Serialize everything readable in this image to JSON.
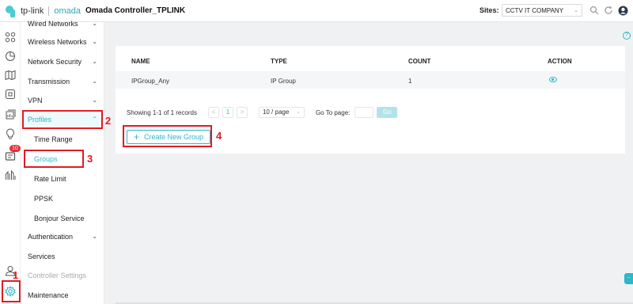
{
  "topbar": {
    "brand": "tp-link",
    "product": "omada",
    "title": "Omada Controller_TPLINK",
    "sites_label": "Sites:",
    "site_selected": "CCTV IT COMPANY"
  },
  "sidebar": {
    "items": [
      {
        "label": "Wired Networks",
        "chevron": "⌄"
      },
      {
        "label": "Wireless Networks",
        "chevron": "⌄"
      },
      {
        "label": "Network Security",
        "chevron": "⌄"
      },
      {
        "label": "Transmission",
        "chevron": "⌄"
      },
      {
        "label": "VPN",
        "chevron": "⌄"
      },
      {
        "label": "Profiles",
        "chevron": "⌃"
      },
      {
        "label": "Time Range"
      },
      {
        "label": "Groups"
      },
      {
        "label": "Rate Limit"
      },
      {
        "label": "PPSK"
      },
      {
        "label": "Bonjour Service"
      },
      {
        "label": "Authentication",
        "chevron": "⌄"
      },
      {
        "label": "Services"
      },
      {
        "label": "Controller Settings"
      },
      {
        "label": "Maintenance"
      }
    ]
  },
  "rail": {
    "badge_count": "10"
  },
  "table": {
    "headers": [
      "NAME",
      "TYPE",
      "COUNT",
      "ACTION"
    ],
    "rows": [
      {
        "name": "IPGroup_Any",
        "type": "IP Group",
        "count": "1",
        "action": "view-icon"
      }
    ]
  },
  "pager": {
    "summary": "Showing 1-1 of 1 records",
    "prev": "<",
    "current_page": "1",
    "next": ">",
    "per_page": "10 / page",
    "goto_label": "Go To page:",
    "go_button": "Go"
  },
  "create_button": {
    "plus": "+",
    "label": "Create New Group"
  },
  "annotations": [
    "1",
    "2",
    "3",
    "4"
  ],
  "help": "?",
  "chat": "··",
  "colors": {
    "accent": "#2eb6c9",
    "annotation_red": "#e01b24",
    "badge_red": "#e0303b"
  }
}
